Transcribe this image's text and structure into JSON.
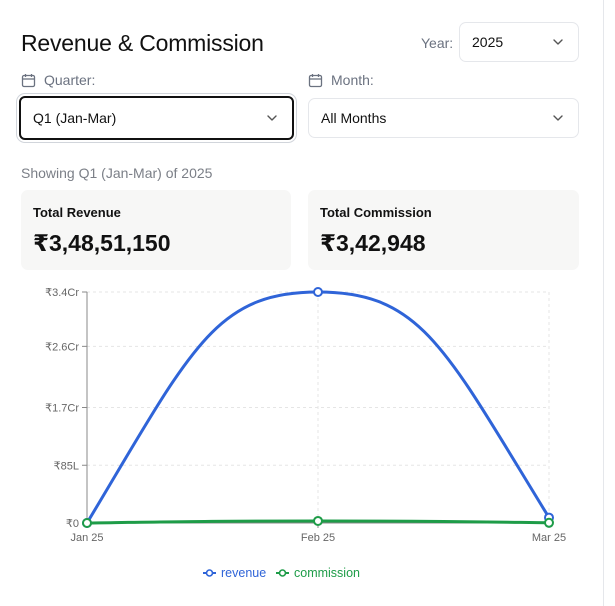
{
  "header": {
    "title": "Revenue & Commission",
    "year_label": "Year:",
    "year_value": "2025"
  },
  "filters": {
    "quarter_label": "Quarter:",
    "quarter_value": "Q1 (Jan-Mar)",
    "month_label": "Month:",
    "month_value": "All Months"
  },
  "summary": {
    "showing_text": "Showing Q1 (Jan-Mar) of 2025"
  },
  "cards": {
    "revenue_label": "Total Revenue",
    "revenue_value": "₹3,48,51,150",
    "commission_label": "Total Commission",
    "commission_value": "₹3,42,948"
  },
  "colors": {
    "revenue": "#2f64d8",
    "commission": "#1e9c48"
  },
  "chart_data": {
    "type": "line",
    "x": [
      "Jan 25",
      "Feb 25",
      "Mar 25"
    ],
    "series": [
      {
        "name": "revenue",
        "values": [
          0,
          34000000,
          800000
        ]
      },
      {
        "name": "commission",
        "values": [
          0,
          300000,
          30000
        ]
      }
    ],
    "yticks": [
      0,
      8500000,
      17000000,
      26000000,
      34000000
    ],
    "ytick_labels": [
      "₹0",
      "₹85L",
      "₹1.7Cr",
      "₹2.6Cr",
      "₹3.4Cr"
    ],
    "ylim": [
      0,
      34000000
    ],
    "grid": true,
    "legend": "bottom-center",
    "title": "",
    "xlabel": "",
    "ylabel": ""
  }
}
